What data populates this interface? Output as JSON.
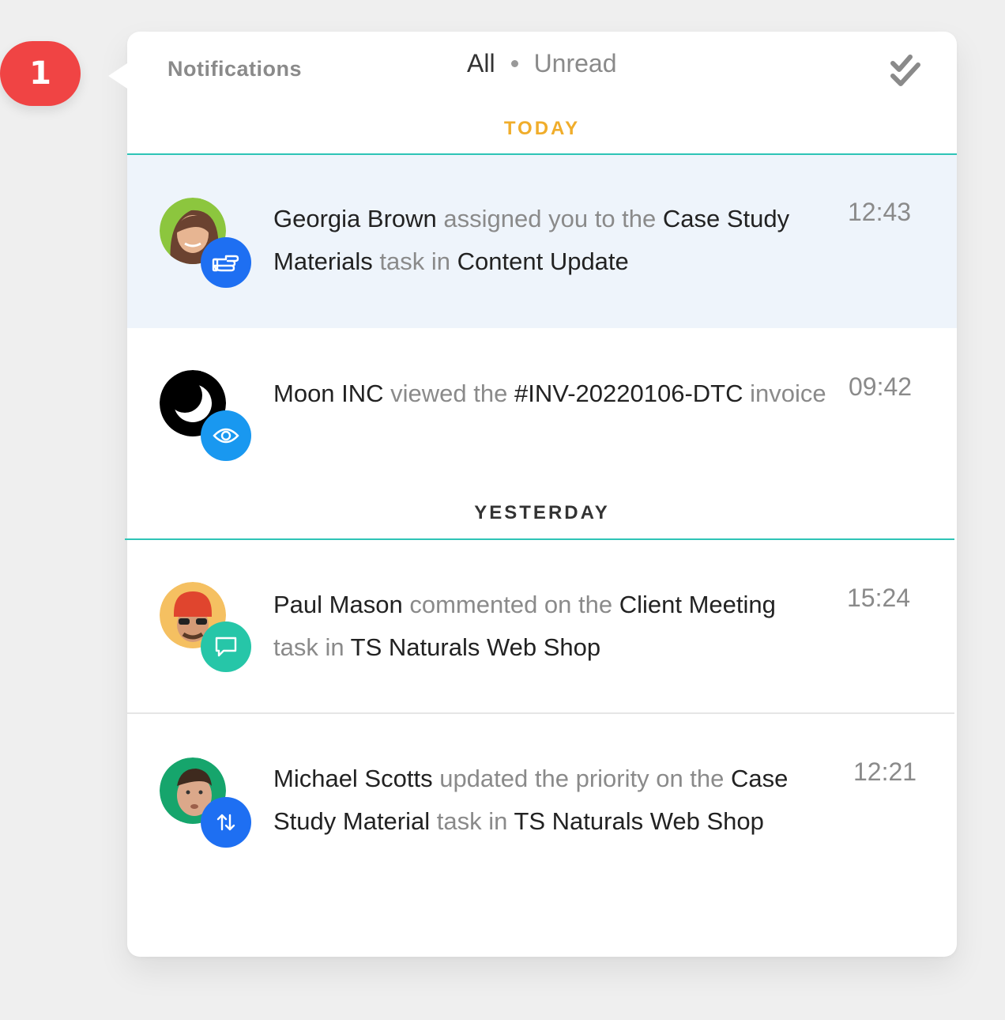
{
  "badge": {
    "count": "1"
  },
  "header": {
    "title": "Notifications",
    "filter_all": "All",
    "filter_unread": "Unread"
  },
  "sections": {
    "today": "TODAY",
    "yesterday": "YESTERDAY"
  },
  "notifications": [
    {
      "actor": "Georgia Brown",
      "action": "assigned you to the",
      "object": "Case Study Materials",
      "connector": "task in",
      "target": "Content Update",
      "time": "12:43",
      "icon": "hand-pointing-icon",
      "icon_color": "#1e6ff2"
    },
    {
      "actor": "Moon INC",
      "action": "viewed the",
      "object": "#INV-20220106-DTC",
      "suffix": "invoice",
      "time": "09:42",
      "icon": "eye-icon",
      "icon_color": "#1998f0"
    },
    {
      "actor": "Paul Mason",
      "action": "commented on the",
      "object": "Client Meeting",
      "connector": "task in",
      "target": "TS Naturals Web Shop",
      "time": "15:24",
      "icon": "comment-icon",
      "icon_color": "#26c6a8"
    },
    {
      "actor": "Michael Scotts",
      "action": "updated the priority on the",
      "object": "Case Study Material",
      "connector": "task in",
      "target": "TS Naturals Web Shop",
      "time": "12:21",
      "icon": "priority-arrows-icon",
      "icon_color": "#1e6ff2"
    }
  ],
  "colors": {
    "badge": "#f04444",
    "today_label": "#f0ad2b",
    "divider": "#2ec4b6",
    "highlight_row": "#eef4fb"
  }
}
